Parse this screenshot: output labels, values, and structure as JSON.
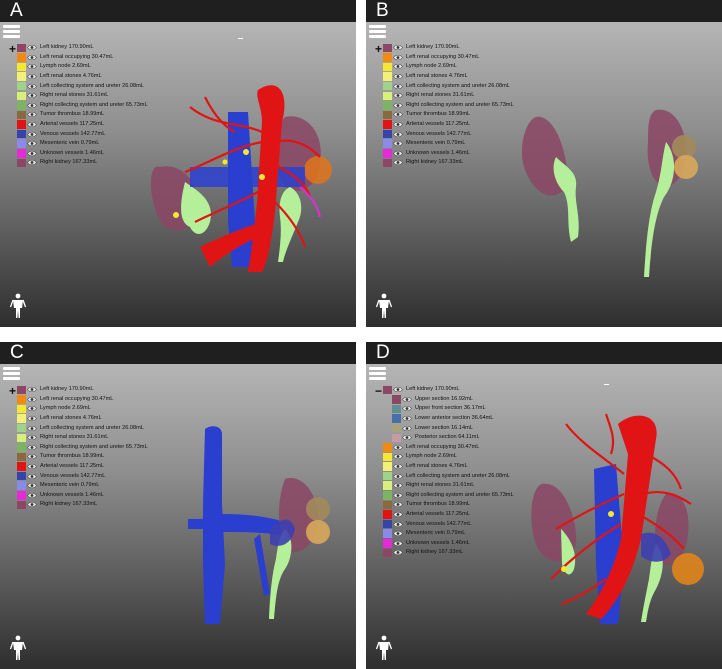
{
  "panels": [
    {
      "label": "A",
      "tree_toggle": "+",
      "legend": [
        {
          "name": "Left kidney 170.90mL",
          "color": "#8b4764"
        },
        {
          "name": "Left renal occupying 30.47mL",
          "color": "#f08a12"
        },
        {
          "name": "Lymph node 2.69mL",
          "color": "#f5e830"
        },
        {
          "name": "Left renal stones 4.76mL",
          "color": "#f2f07a"
        },
        {
          "name": "Left collecting system and ureter 26.08mL",
          "color": "#9fd38a"
        },
        {
          "name": "Right renal stones 31.61mL",
          "color": "#d8ef7a"
        },
        {
          "name": "Right collecting system and ureter 65.73mL",
          "color": "#7db463"
        },
        {
          "name": "Tumor thrombus 18.99mL",
          "color": "#8a6a3d"
        },
        {
          "name": "Arterial vessels 117.25mL",
          "color": "#e01414"
        },
        {
          "name": "Venous vessels 142.77mL",
          "color": "#3345a8"
        },
        {
          "name": "Mesenteric vein 0.79mL",
          "color": "#8a8ae8"
        },
        {
          "name": "Unknown vessels 1.46mL",
          "color": "#e52ad8"
        },
        {
          "name": "Right kidney 167.33mL",
          "color": "#8b4764"
        }
      ]
    },
    {
      "label": "B",
      "tree_toggle": "+",
      "legend": [
        {
          "name": "Left kidney 170.90mL",
          "color": "#8b4764"
        },
        {
          "name": "Left renal occupying 30.47mL",
          "color": "#f08a12"
        },
        {
          "name": "Lymph node 2.69mL",
          "color": "#f5e830"
        },
        {
          "name": "Left renal stones 4.76mL",
          "color": "#f2f07a"
        },
        {
          "name": "Left collecting system and ureter 26.08mL",
          "color": "#9fd38a"
        },
        {
          "name": "Right renal stones 31.61mL",
          "color": "#d8ef7a"
        },
        {
          "name": "Right collecting system and ureter 65.73mL",
          "color": "#7db463"
        },
        {
          "name": "Tumor thrombus 18.99mL",
          "color": "#8a6a3d"
        },
        {
          "name": "Arterial vessels 117.25mL",
          "color": "#e01414"
        },
        {
          "name": "Venous vessels 142.77mL",
          "color": "#3345a8"
        },
        {
          "name": "Mesenteric vein 0.79mL",
          "color": "#8a8ae8"
        },
        {
          "name": "Unknown vessels 1.46mL",
          "color": "#e52ad8"
        },
        {
          "name": "Right kidney 167.33mL",
          "color": "#8b4764"
        }
      ]
    },
    {
      "label": "C",
      "tree_toggle": "+",
      "legend": [
        {
          "name": "Left kidney 170.90mL",
          "color": "#8b4764"
        },
        {
          "name": "Left renal occupying 30.47mL",
          "color": "#f08a12"
        },
        {
          "name": "Lymph node 2.69mL",
          "color": "#f5e830"
        },
        {
          "name": "Left renal stones 4.76mL",
          "color": "#f2f07a"
        },
        {
          "name": "Left collecting system and ureter 26.08mL",
          "color": "#9fd38a"
        },
        {
          "name": "Right renal stones 31.61mL",
          "color": "#d8ef7a"
        },
        {
          "name": "Right collecting system and ureter 65.73mL",
          "color": "#7db463"
        },
        {
          "name": "Tumor thrombus 18.99mL",
          "color": "#8a6a3d"
        },
        {
          "name": "Arterial vessels 117.25mL",
          "color": "#e01414"
        },
        {
          "name": "Venous vessels 142.77mL",
          "color": "#3345a8"
        },
        {
          "name": "Mesenteric vein 0.79mL",
          "color": "#8a8ae8"
        },
        {
          "name": "Unknown vessels 1.46mL",
          "color": "#e52ad8"
        },
        {
          "name": "Right kidney 167.33mL",
          "color": "#8b4764"
        }
      ]
    },
    {
      "label": "D",
      "tree_toggle": "−",
      "legend": [
        {
          "name": "Left kidney 170.90mL",
          "color": "#8b4764"
        },
        {
          "name": "Upper section 16.92mL",
          "color": "#8b4764",
          "sub": true
        },
        {
          "name": "Upper front section 36.17mL",
          "color": "#5f8f8f",
          "sub": true
        },
        {
          "name": "Lower anterior section 36.64mL",
          "color": "#4a6fa8",
          "sub": true
        },
        {
          "name": "Lower section 16.14mL",
          "color": "#a8a37a",
          "sub": true
        },
        {
          "name": "Posterior section 64.11mL",
          "color": "#c79aa8",
          "sub": true
        },
        {
          "name": "Left renal occupying 30.47mL",
          "color": "#f08a12"
        },
        {
          "name": "Lymph node 2.69mL",
          "color": "#f5e830"
        },
        {
          "name": "Left renal stones 4.76mL",
          "color": "#f2f07a"
        },
        {
          "name": "Left collecting system and ureter 26.08mL",
          "color": "#9fd38a"
        },
        {
          "name": "Right renal stones 31.61mL",
          "color": "#d8ef7a"
        },
        {
          "name": "Right collecting system and ureter 65.73mL",
          "color": "#7db463"
        },
        {
          "name": "Tumor thrombus 18.99mL",
          "color": "#8a6a3d"
        },
        {
          "name": "Arterial vessels 117.25mL",
          "color": "#e01414"
        },
        {
          "name": "Venous vessels 142.77mL",
          "color": "#3345a8"
        },
        {
          "name": "Mesenteric vein 0.79mL",
          "color": "#8a8ae8"
        },
        {
          "name": "Unknown vessels 1.46mL",
          "color": "#e52ad8"
        },
        {
          "name": "Right kidney 167.33mL",
          "color": "#8b4764"
        }
      ]
    }
  ],
  "icons": {
    "menu": "hamburger-menu-icon",
    "visibility": "eye-icon",
    "orientation": "person-orientation-icon"
  }
}
